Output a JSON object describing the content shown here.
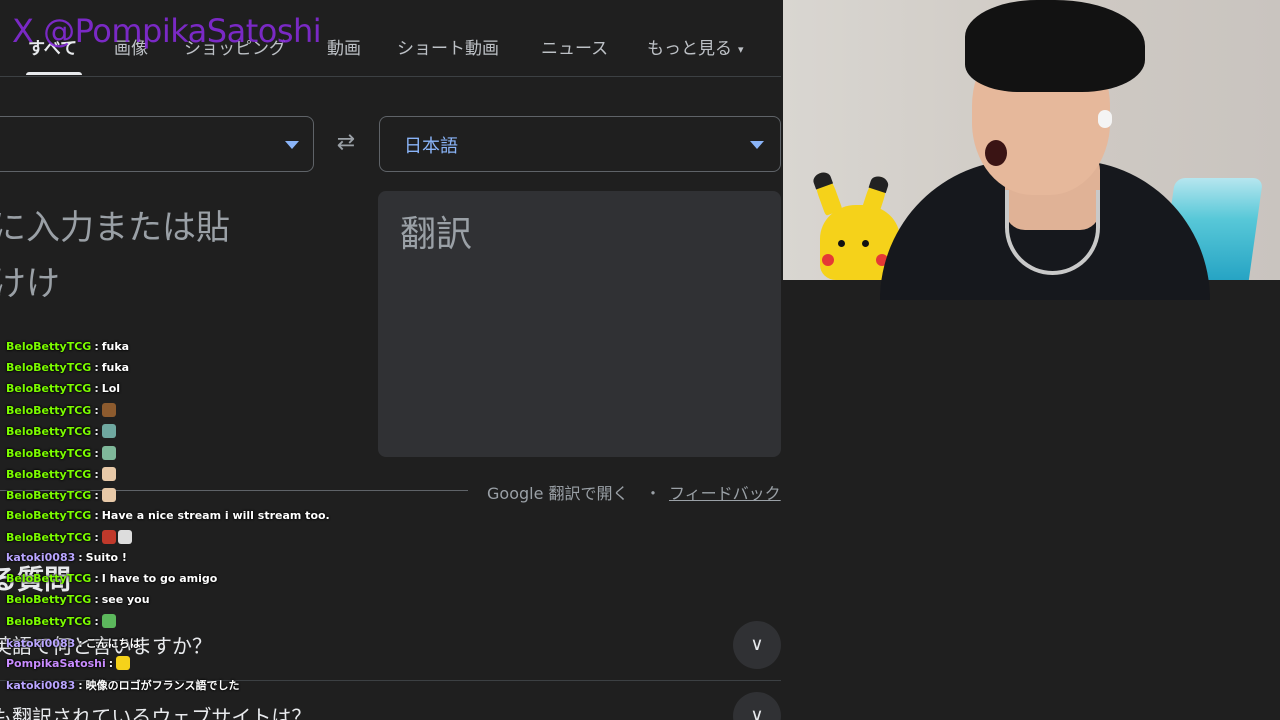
{
  "watermark": "X @PompikaSatoshi",
  "tabs": [
    {
      "label": "すべて",
      "active": true
    },
    {
      "label": "画像"
    },
    {
      "label": "ショッピング"
    },
    {
      "label": "動画"
    },
    {
      "label": "ショート動画"
    },
    {
      "label": "ニュース"
    },
    {
      "label": "もっと見る"
    }
  ],
  "translate": {
    "target_lang": "日本語",
    "source_placeholder_line1": "に入力または貼",
    "source_placeholder_line2": "けけ",
    "target_placeholder": "翻訳",
    "open_in": "Google 翻訳で開く",
    "dot": "・",
    "feedback": "フィードバック"
  },
  "related": {
    "heading": "る質問",
    "items": [
      "英語で何と言いますか？",
      "も翻訳されているウェブサイトは？"
    ]
  },
  "chat": [
    {
      "user": "BeloBettyTCG",
      "msg": "fuka"
    },
    {
      "user": "BeloBettyTCG",
      "msg": "fuka"
    },
    {
      "user": "BeloBettyTCG",
      "msg": "Lol"
    },
    {
      "user": "BeloBettyTCG",
      "msg": "",
      "emote": "#8d5b2e"
    },
    {
      "user": "BeloBettyTCG",
      "msg": "",
      "emote": "#6fa8a0"
    },
    {
      "user": "BeloBettyTCG",
      "msg": "",
      "emote": "#7fb89a"
    },
    {
      "user": "BeloBettyTCG",
      "msg": "",
      "emote": "#e8c9a8"
    },
    {
      "user": "BeloBettyTCG",
      "msg": "",
      "emote": "#e8c9a8"
    },
    {
      "user": "BeloBettyTCG",
      "msg": "Have a nice stream i will stream too."
    },
    {
      "user": "BeloBettyTCG",
      "msg": "",
      "emote": "#c0392b"
    },
    {
      "user": "katoki0083",
      "msg": "Suito !"
    },
    {
      "user": "BeloBettyTCG",
      "msg": "I have to go amigo"
    },
    {
      "user": "BeloBettyTCG",
      "msg": "see you"
    },
    {
      "user": "BeloBettyTCG",
      "msg": "",
      "emote": "#5cb85c"
    },
    {
      "user": "katoki0083",
      "msg": "こんにちは"
    },
    {
      "user": "PompikaSatoshi",
      "msg": "",
      "emote": "#f5d21a"
    },
    {
      "user": "katoki0083",
      "msg": "映像のロゴがフランス語でした"
    }
  ]
}
